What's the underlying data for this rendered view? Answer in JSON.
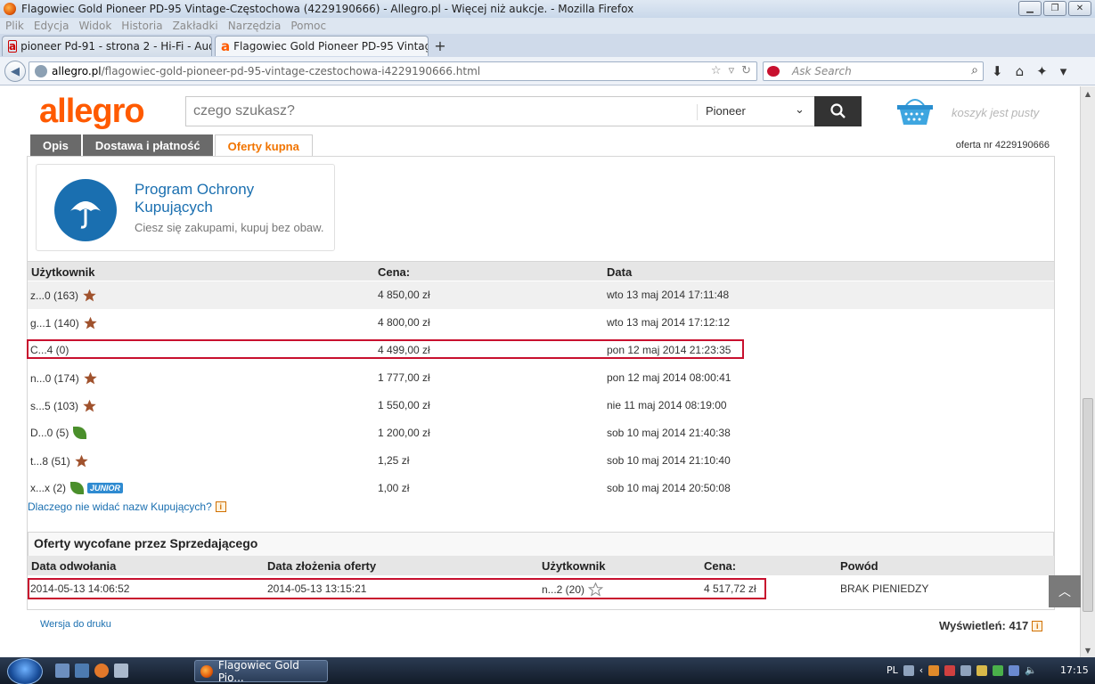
{
  "window": {
    "title": "Flagowiec Gold Pioneer PD-95 Vintage-Częstochowa (4229190666) - Allegro.pl - Więcej niż aukcje. - Mozilla Firefox"
  },
  "menu": [
    "Plik",
    "Edycja",
    "Widok",
    "Historia",
    "Zakładki",
    "Narzędzia",
    "Pomoc"
  ],
  "tabs": [
    {
      "label": "pioneer Pd-91 - strona 2 - Hi-Fi - Aud..."
    },
    {
      "label": "Flagowiec Gold Pioneer PD-95 Vintag..."
    }
  ],
  "address": {
    "domain": "allegro.pl",
    "path": "/flagowiec-gold-pioneer-pd-95-vintage-czestochowa-i4229190666.html"
  },
  "browser_search": {
    "placeholder": "Ask Search"
  },
  "site": {
    "logo": "allegro",
    "search_placeholder": "czego szukasz?",
    "category": "Pioneer",
    "basket_label": "koszyk jest pusty"
  },
  "page_tabs": [
    "Opis",
    "Dostawa i płatność",
    "Oferty kupna"
  ],
  "offer_nr": "oferta nr 4229190666",
  "protection": {
    "title": "Program Ochrony Kupujących",
    "subtitle": "Ciesz się zakupami, kupuj bez obaw."
  },
  "bids": {
    "headers": [
      "Użytkownik",
      "Cena:",
      "Data"
    ],
    "rows": [
      {
        "user": "z...0 (163)",
        "price": "4 850,00 zł",
        "date": "wto 13 maj 2014 17:11:48"
      },
      {
        "user": "g...1 (140)",
        "price": "4 800,00 zł",
        "date": "wto 13 maj 2014 17:12:12"
      },
      {
        "user": "C...4 (0)",
        "price": "4 499,00 zł",
        "date": "pon 12 maj 2014 21:23:35"
      },
      {
        "user": "n...0 (174)",
        "price": "1 777,00 zł",
        "date": "pon 12 maj 2014 08:00:41"
      },
      {
        "user": "s...5 (103)",
        "price": "1 550,00 zł",
        "date": "nie 11 maj 2014 08:19:00"
      },
      {
        "user": "D...0 (5)",
        "price": "1 200,00 zł",
        "date": "sob 10 maj 2014 21:40:38"
      },
      {
        "user": "t...8 (51)",
        "price": "1,25 zł",
        "date": "sob 10 maj 2014 21:10:40"
      },
      {
        "user": "x...x (2)",
        "price": "1,00 zł",
        "date": "sob 10 maj 2014 20:50:08"
      }
    ],
    "junior_badge": "JUNIOR"
  },
  "why_link": "Dlaczego nie widać nazw Kupujących?",
  "withdrawn": {
    "title": "Oferty wycofane przez Sprzedającego",
    "headers": [
      "Data odwołania",
      "Data złożenia oferty",
      "Użytkownik",
      "Cena:",
      "Powód"
    ],
    "row": {
      "cancel_date": "2014-05-13 14:06:52",
      "offer_date": "2014-05-13 13:15:21",
      "user": "n...2 (20)",
      "price": "4 517,72 zł",
      "reason": "BRAK PIENIEDZY"
    }
  },
  "print_link": "Wersja do druku",
  "views": "Wyświetleń: 417",
  "taskbar": {
    "task_label": "Flagowiec Gold Pio...",
    "lang": "PL",
    "clock": "17:15"
  },
  "colors": {
    "brand": "#ff5a00",
    "highlight": "#c8102e",
    "link": "#1a6fb0"
  }
}
